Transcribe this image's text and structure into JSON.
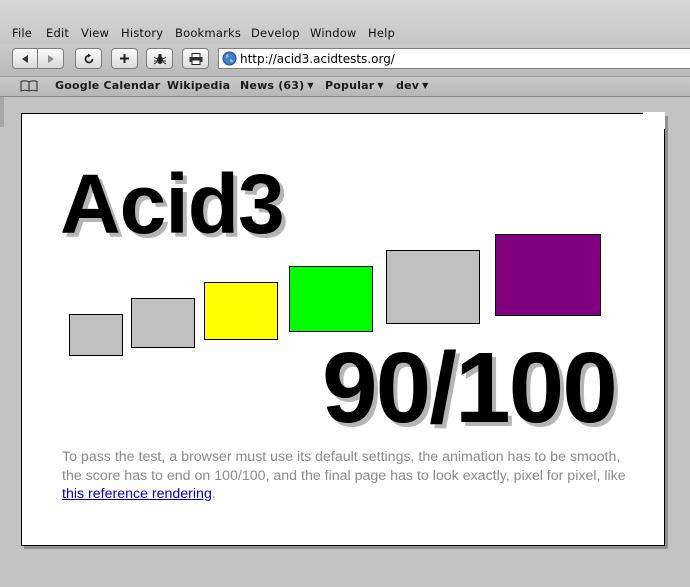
{
  "menu": {
    "items": [
      "File",
      "Edit",
      "View",
      "History",
      "Bookmarks",
      "Develop",
      "Window",
      "Help"
    ]
  },
  "toolbar": {
    "address": "http://acid3.acidtests.org/"
  },
  "bookmarks": {
    "google_calendar": "Google Calendar",
    "wikipedia": "Wikipedia",
    "news": "News (63)",
    "popular": "Popular",
    "dev": "dev"
  },
  "page": {
    "title": "Acid3",
    "score": "90/100",
    "desc_prefix": "To pass the test, a browser must use its default settings, the animation has to be smooth, the score has to end on 100/100, and the final page has to look exactly, pixel for pixel, like ",
    "link_text": "this reference rendering",
    "desc_suffix": "."
  },
  "colors": {
    "box_gray": "#c0c0c0",
    "box_yellow": "#ffff00",
    "box_green": "#00ff00",
    "box_purple": "#800080",
    "link": "#0000cc"
  }
}
